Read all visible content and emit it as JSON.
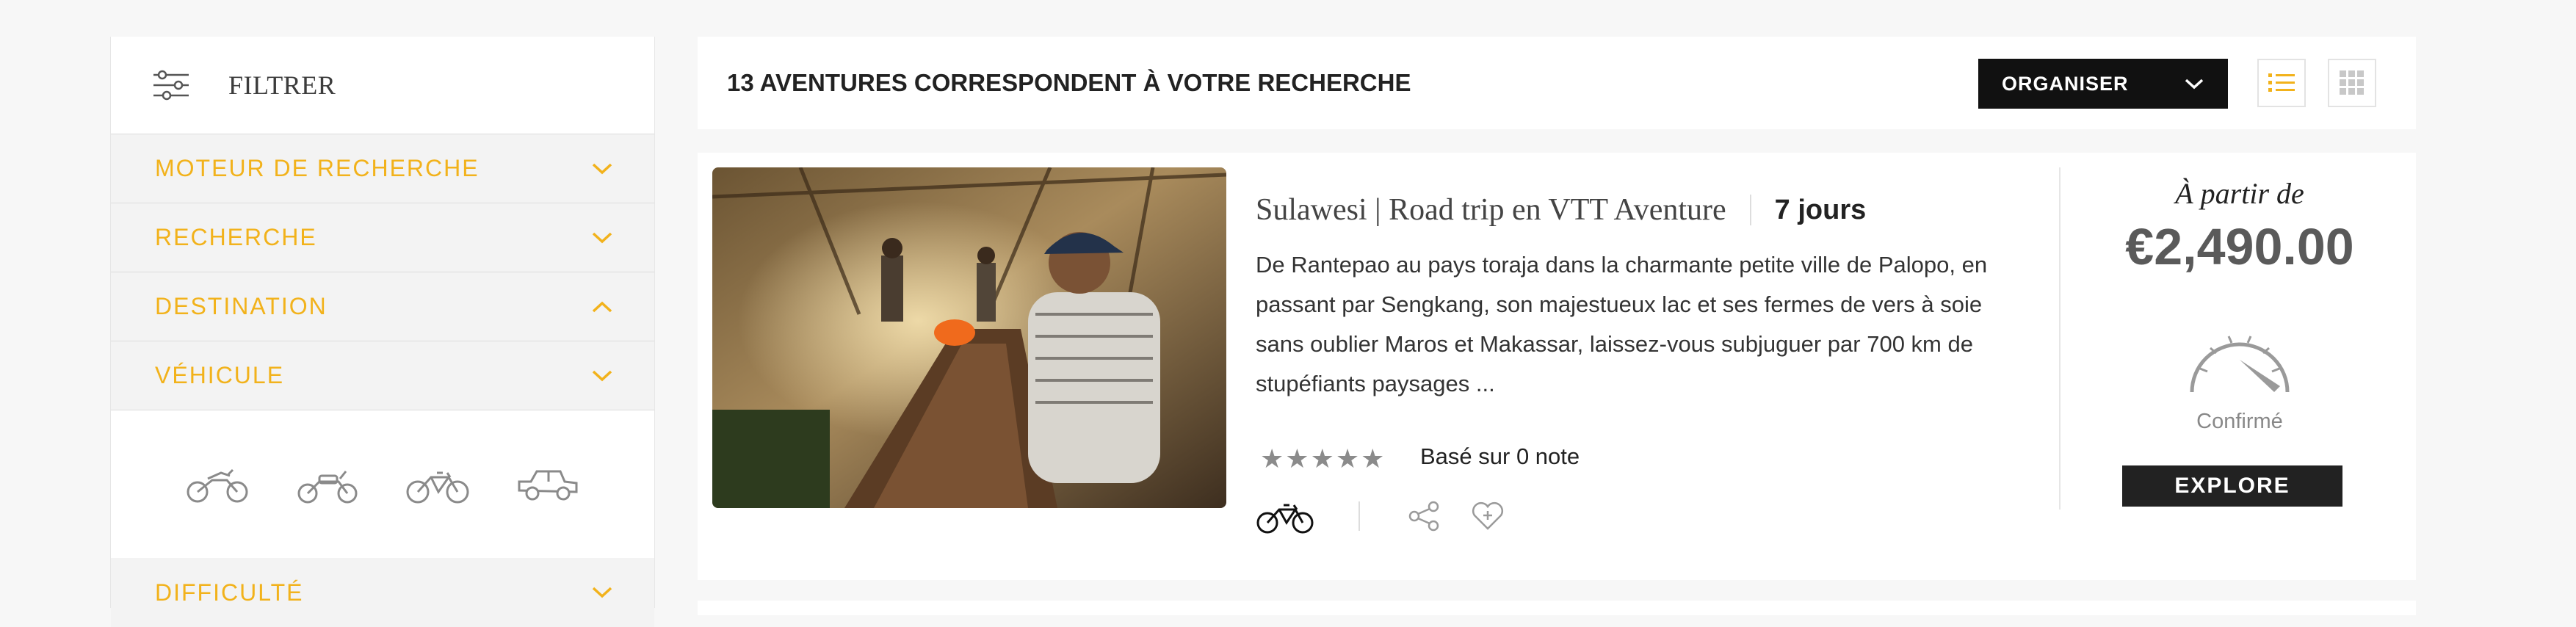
{
  "sidebar": {
    "title": "FILTRER",
    "sections": [
      {
        "label": "MOTEUR DE RECHERCHE",
        "state": "collapsed"
      },
      {
        "label": "RECHERCHE",
        "state": "collapsed"
      },
      {
        "label": "DESTINATION",
        "state": "expanded"
      },
      {
        "label": "VÉHICULE",
        "state": "collapsed"
      }
    ],
    "vehicles": [
      "dirt-bike-icon",
      "motorcycle-icon",
      "bicycle-icon",
      "jeep-icon"
    ],
    "last_section": {
      "label": "DIFFICULTÉ",
      "state": "collapsed"
    }
  },
  "results": {
    "count_text": "13 AVENTURES CORRESPONDENT À VOTRE RECHERCHE",
    "sort_label": "ORGANISER",
    "view_modes": [
      "list",
      "grid"
    ],
    "active_view": "list"
  },
  "card": {
    "title": "Sulawesi | Road trip en VTT Aventure",
    "duration": "7 jours",
    "description": "De Rantepao au pays toraja dans la charmante petite ville de Palopo, en passant par Sengkang, son majestueux lac et ses fermes de vers à soie sans oublier Maros et Makassar, laissez-vous subjuguer par 700 km de stupéfiants paysages ...",
    "stars": 5,
    "rating_text": "Basé sur 0 note",
    "price_from": "À partir de",
    "price": "€2,490.00",
    "level": "Confirmé",
    "cta": "EXPLORE"
  },
  "colors": {
    "accent": "#f2b21b",
    "dark": "#111111",
    "background": "#f7f7f7"
  }
}
